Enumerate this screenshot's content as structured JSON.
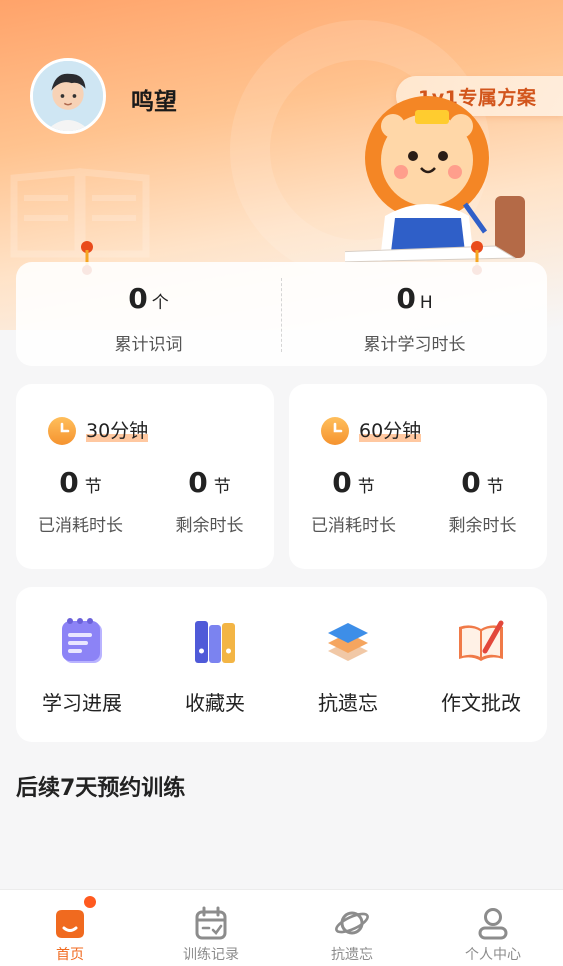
{
  "profile": {
    "name": "鸣望"
  },
  "plan_badge": "1v1专属方案",
  "stats": [
    {
      "value": "0",
      "unit": "个",
      "label": "累计识词"
    },
    {
      "value": "0",
      "unit": "H",
      "label": "累计学习时长"
    }
  ],
  "durations": [
    {
      "title": "30分钟",
      "used_value": "0",
      "used_unit": "节",
      "used_label": "已消耗时长",
      "left_value": "0",
      "left_unit": "节",
      "left_label": "剩余时长"
    },
    {
      "title": "60分钟",
      "used_value": "0",
      "used_unit": "节",
      "used_label": "已消耗时长",
      "left_value": "0",
      "left_unit": "节",
      "left_label": "剩余时长"
    }
  ],
  "tools": [
    {
      "label": "学习进展",
      "icon": "notepad-icon"
    },
    {
      "label": "收藏夹",
      "icon": "binders-icon"
    },
    {
      "label": "抗遗忘",
      "icon": "stack-icon"
    },
    {
      "label": "作文批改",
      "icon": "open-book-pencil-icon"
    }
  ],
  "section_title": "后续7天预约训练",
  "tabbar": [
    {
      "label": "首页",
      "icon": "home-icon",
      "active": true,
      "badge": true
    },
    {
      "label": "训练记录",
      "icon": "calendar-icon",
      "active": false
    },
    {
      "label": "抗遗忘",
      "icon": "planet-icon",
      "active": false
    },
    {
      "label": "个人中心",
      "icon": "user-icon",
      "active": false
    }
  ],
  "colors": {
    "accent": "#f06a1f",
    "badge_text": "#d2551c",
    "clock": "#f5932f"
  }
}
